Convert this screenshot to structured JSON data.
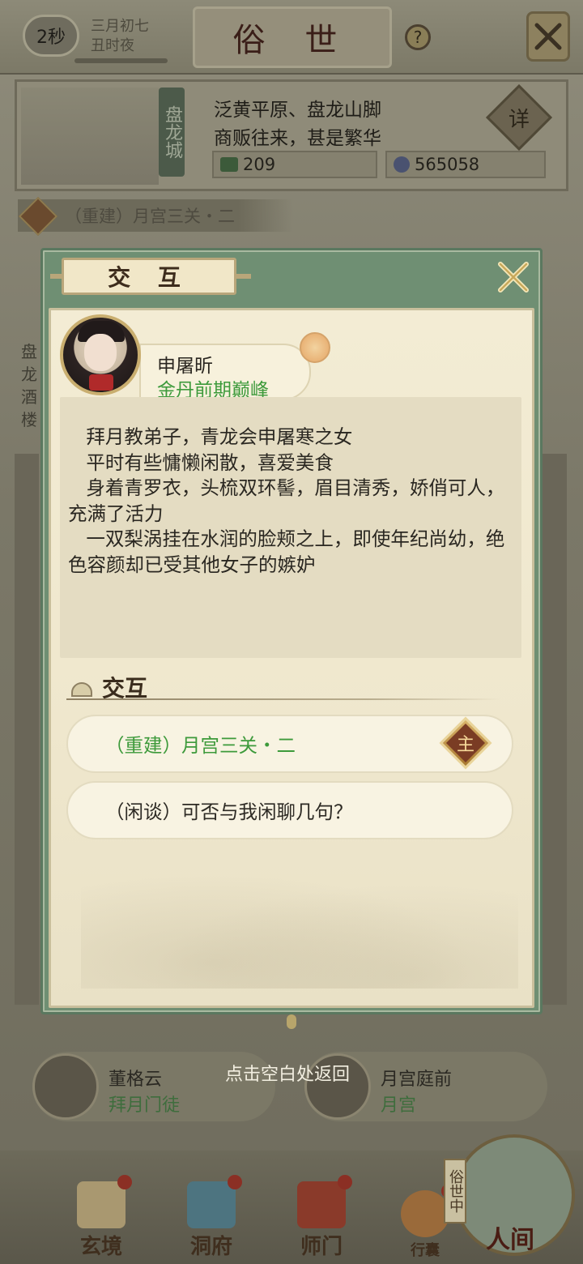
{
  "header": {
    "timer": "2秒",
    "date_line1": "三月初七",
    "date_line2": "丑时夜",
    "title": "俗 世",
    "help_glyph": "?"
  },
  "city": {
    "name": "盘龙城",
    "desc_line1": "泛黄平原、盘龙山脚",
    "desc_line2": "商贩往来，甚是繁华",
    "resource1": "209",
    "resource2": "565058",
    "detail_label": "详"
  },
  "quest_bar": {
    "badge": "主",
    "text": "（重建）月宫三关・二"
  },
  "left_strip": "盘龙酒楼",
  "dialog": {
    "title": "交 互",
    "character_name": "申屠昕",
    "character_realm": "金丹前期巅峰",
    "description": "   拜月教弟子，青龙会申屠寒之女\n   平时有些慵懒闲散，喜爱美食\n   身着青罗衣，头梳双环髻，眉目清秀，娇俏可人，充满了活力\n   一双梨涡挂在水润的脸颊之上，即使年纪尚幼，绝色容颜却已受其他女子的嫉妒",
    "section_title": "交互",
    "options": [
      {
        "label": "（重建）月宫三关・二",
        "badge": "主"
      },
      {
        "label": "（闲谈）可否与我闲聊几句？"
      }
    ]
  },
  "background_npcs": [
    {
      "name": "董格云",
      "sub": "拜月门徒"
    },
    {
      "name": "月宫庭前",
      "sub": "月宫"
    }
  ],
  "hint": "点击空白处返回",
  "bottom_nav": {
    "items": [
      {
        "label": "玄境"
      },
      {
        "label": "洞府"
      },
      {
        "label": "师门"
      },
      {
        "label": "行囊"
      }
    ],
    "world_label": "人间",
    "world_side": "俗世中"
  },
  "colors": {
    "realm_green": "#3d9a3b",
    "dialog_frame": "#6f8f73",
    "parchment": "#f3ecd4"
  }
}
